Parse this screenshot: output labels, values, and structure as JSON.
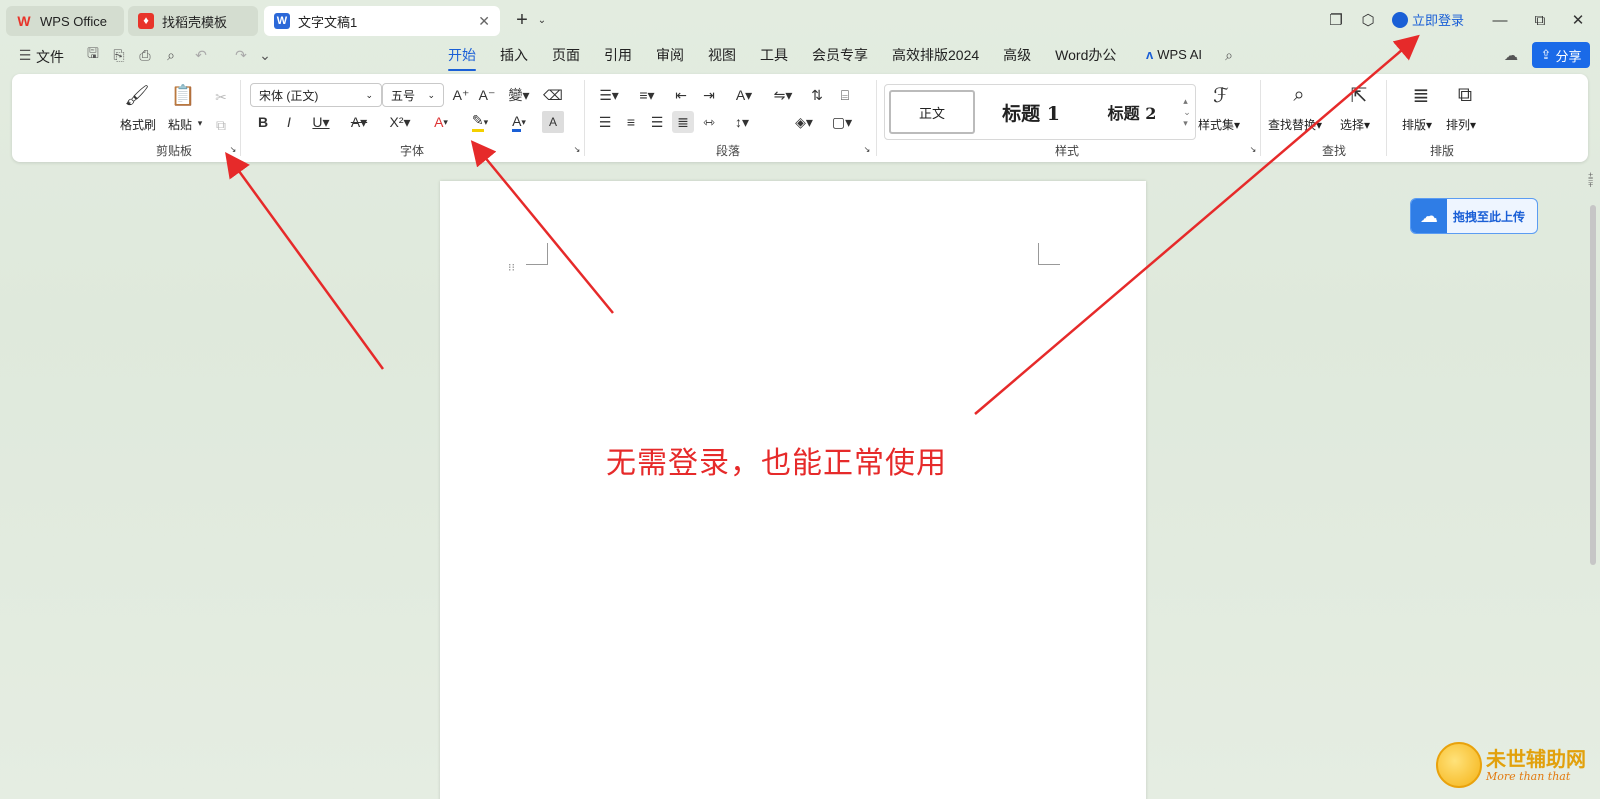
{
  "tabs": [
    {
      "label": "WPS Office",
      "logo_color": "#e8342a"
    },
    {
      "label": "找稻壳模板",
      "logo_color": "#e8342a"
    },
    {
      "label": "文字文稿1",
      "logo_color": "#2b68d8",
      "logo_text": "W"
    }
  ],
  "titlebar": {
    "login_label": "立即登录",
    "share_label": "分享"
  },
  "menu": {
    "file_label": "文件",
    "items": [
      "开始",
      "插入",
      "页面",
      "引用",
      "审阅",
      "视图",
      "工具",
      "会员专享",
      "高效排版2024",
      "高级",
      "Word办公"
    ],
    "active_index": 0,
    "ai_label": "WPS AI"
  },
  "ribbon": {
    "clipboard": {
      "format_painter": "格式刷",
      "paste": "粘贴",
      "group_label": "剪贴板"
    },
    "font": {
      "font_name": "宋体 (正文)",
      "font_size": "五号",
      "group_label": "字体"
    },
    "paragraph": {
      "group_label": "段落"
    },
    "styles": {
      "normal": "正文",
      "h1": "标题 1",
      "h2": "标题 2",
      "style_set": "样式集",
      "group_label": "样式"
    },
    "find": {
      "find_replace": "查找替换",
      "select": "选择",
      "group_label": "查找"
    },
    "layout": {
      "arrange": "排版",
      "order": "排列",
      "group_label": "排版"
    }
  },
  "document": {
    "annotation": "无需登录，也能正常使用"
  },
  "upload_label": "拖拽至此上传",
  "watermark": {
    "title": "未世辅助网",
    "subtitle": "More than that"
  },
  "colors": {
    "accent": "#1a5fd6",
    "arrow": "#e62a2a",
    "ribbon_bg": "#ffffff"
  }
}
